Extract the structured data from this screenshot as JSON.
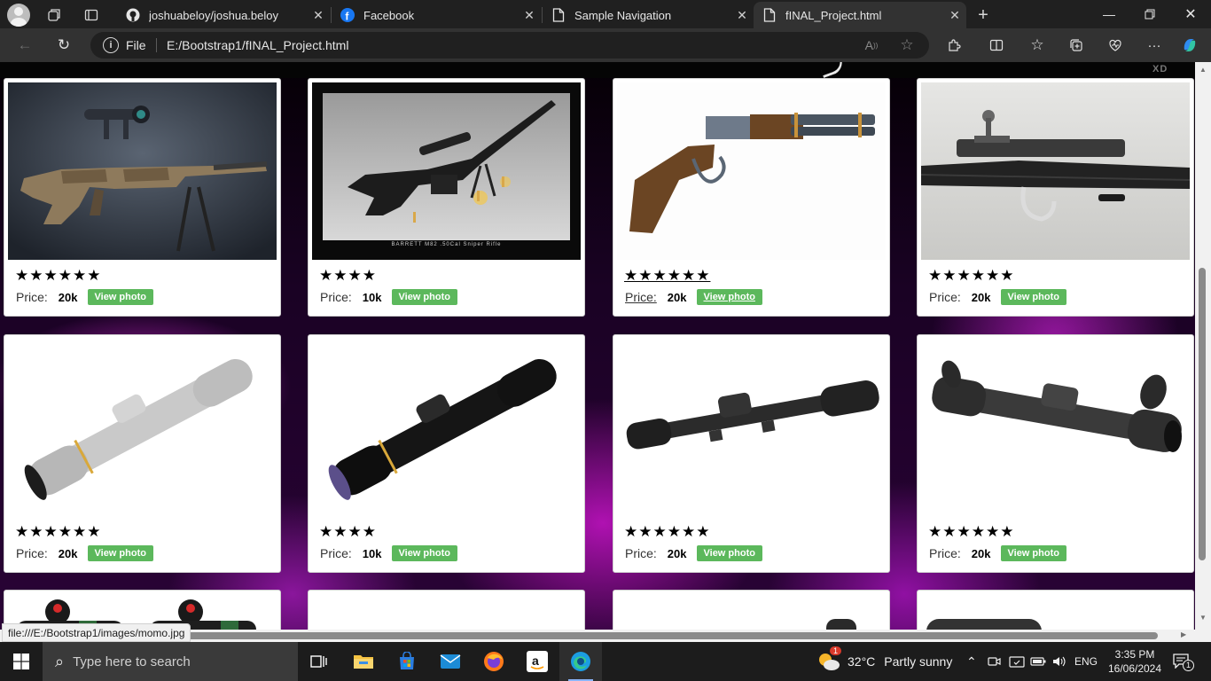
{
  "browser": {
    "tabs": [
      {
        "title": "joshuabeloy/joshua.beloy",
        "icon": "github-icon"
      },
      {
        "title": "Facebook",
        "icon": "facebook-icon"
      },
      {
        "title": "Sample Navigation",
        "icon": "page-icon"
      },
      {
        "title": "fINAL_Project.html",
        "icon": "page-icon",
        "active": true
      }
    ],
    "address": {
      "scheme": "File",
      "url": "E:/Bootstrap1/fINAL_Project.html"
    }
  },
  "page": {
    "cards": [
      {
        "image": "sniper-rifle-camo-image",
        "stars": "★★★★★★",
        "price_label": "Price:",
        "price": "20k",
        "button": "View photo"
      },
      {
        "image": "barrett-m82-image",
        "caption": "BARRETT M82 .50Cal Sniper Rifle",
        "stars": "★★★★",
        "price_label": "Price:",
        "price": "10k",
        "button": "View photo"
      },
      {
        "image": "lever-action-rifle-image",
        "stars": "★★★★★★",
        "price_label": "Price:",
        "price": "20k",
        "button": "View photo",
        "hovered": true
      },
      {
        "image": "bolt-action-rifle-image",
        "stars": "★★★★★★",
        "price_label": "Price:",
        "price": "20k",
        "button": "View photo"
      },
      {
        "image": "silver-scope-image",
        "stars": "★★★★★★",
        "price_label": "Price:",
        "price": "20k",
        "button": "View photo"
      },
      {
        "image": "black-scope-image",
        "stars": "★★★★",
        "price_label": "Price:",
        "price": "10k",
        "button": "View photo"
      },
      {
        "image": "tactical-scope-image",
        "stars": "★★★★★★",
        "price_label": "Price:",
        "price": "20k",
        "button": "View photo"
      },
      {
        "image": "long-range-scope-image",
        "stars": "★★★★★★",
        "price_label": "Price:",
        "price": "20k",
        "button": "View photo"
      }
    ],
    "status_url": "file:///E:/Bootstrap1/images/momo.jpg"
  },
  "taskbar": {
    "search_placeholder": "Type here to search",
    "weather": {
      "temp": "32°C",
      "condition": "Partly sunny",
      "alert": "1"
    },
    "language": "ENG",
    "time": "3:35 PM",
    "date": "16/06/2024",
    "notifications": "1"
  },
  "colors": {
    "view_button": "#5cb85c",
    "background_accent": "#c71fd0"
  }
}
